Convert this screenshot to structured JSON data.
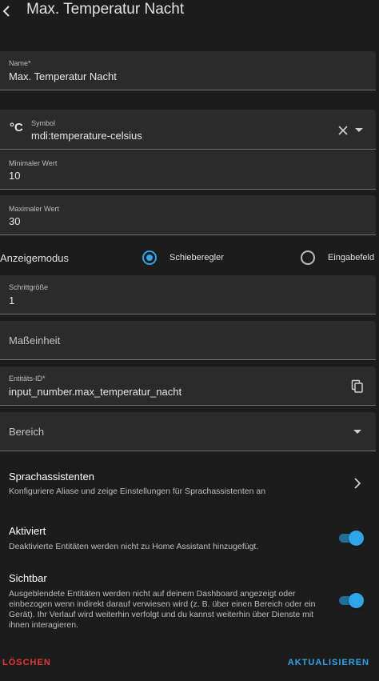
{
  "header": {
    "title": "Max. Temperatur Nacht"
  },
  "fields": {
    "name": {
      "label": "Name*",
      "value": "Max. Temperatur Nacht"
    },
    "symbol": {
      "label": "Symbol",
      "value": "mdi:temperature-celsius",
      "icon_glyph": "°C"
    },
    "min": {
      "label": "Minimaler Wert",
      "value": "10"
    },
    "max": {
      "label": "Maximaler Wert",
      "value": "30"
    },
    "step": {
      "label": "Schrittgröße",
      "value": "1"
    },
    "unit": {
      "placeholder": "Maßeinheit"
    },
    "entity_id": {
      "label": "Entitäts-ID*",
      "value": "input_number.max_temperatur_nacht"
    },
    "area": {
      "placeholder": "Bereich"
    }
  },
  "display_mode": {
    "label": "Anzeigemodus",
    "options": [
      {
        "label": "Schieberegler",
        "selected": true
      },
      {
        "label": "Eingabefeld",
        "selected": false
      }
    ]
  },
  "voice_assistants": {
    "title": "Sprachassistenten",
    "description": "Konfiguriere Aliase und zeige Einstellungen für Sprachassistenten an"
  },
  "enabled": {
    "title": "Aktiviert",
    "description": "Deaktivierte Entitäten werden nicht zu Home Assistant hinzugefügt.",
    "on": true
  },
  "visible": {
    "title": "Sichtbar",
    "description": "Ausgeblendete Entitäten werden nicht auf deinem Dashboard angezeigt oder einbezogen wenn indirekt darauf verwiesen wird (z. B. über einen Bereich oder ein Gerät). Ihr Verlauf wird weiterhin verfolgt und du kannst weiterhin über Dienste mit ihnen interagieren.",
    "on": true
  },
  "actions": {
    "delete_label": "LÖSCHEN",
    "update_label": "AKTUALISIEREN"
  },
  "colors": {
    "accent": "#2fa4e7",
    "danger": "#e53935",
    "background": "#1c1c1c",
    "field_fill": "#2b2b2b"
  },
  "icons": {
    "back": "chevron-left-icon",
    "clear": "close-icon",
    "dropdown": "menu-down-icon",
    "copy": "content-copy-icon",
    "next": "chevron-right-icon"
  }
}
